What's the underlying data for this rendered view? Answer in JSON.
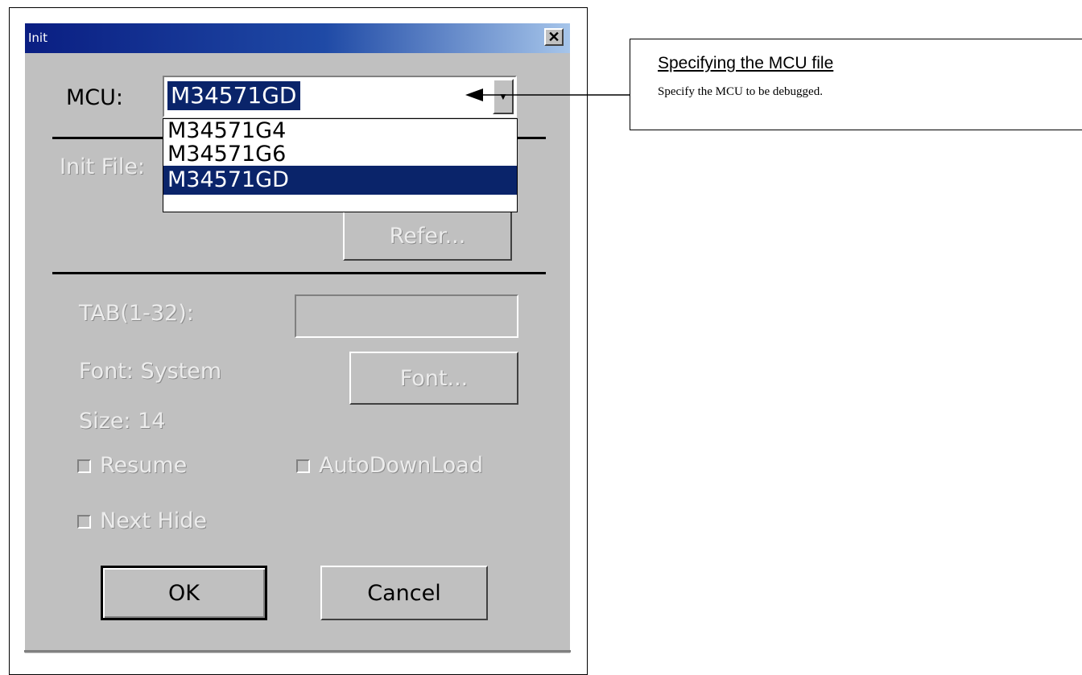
{
  "dialog": {
    "title": "Init",
    "close_glyph": "✕",
    "mcu_label": "MCU:",
    "mcu_selected": "M34571GD",
    "mcu_options": [
      "M34571G4",
      "M34571G6",
      "M34571GD"
    ],
    "init_file_label": "Init File:",
    "refer_label": "Refer...",
    "tab_label": "TAB(1-32):",
    "tab_value": "",
    "font_label": "Font: System",
    "size_label": "Size:  14",
    "font_button": "Font...",
    "resume_label": "Resume",
    "autodownload_label": "AutoDownLoad",
    "nexthide_label": "Next Hide",
    "ok_label": "OK",
    "cancel_label": "Cancel",
    "resume_checked": false,
    "autodownload_checked": false,
    "nexthide_checked": false
  },
  "callout": {
    "title": "Specifying the MCU file",
    "body": "Specify the MCU to be debugged."
  },
  "icons": {
    "dropdown_arrow": "chevron-down-icon",
    "close": "close-icon",
    "pointer": "arrow-pointer-icon"
  }
}
